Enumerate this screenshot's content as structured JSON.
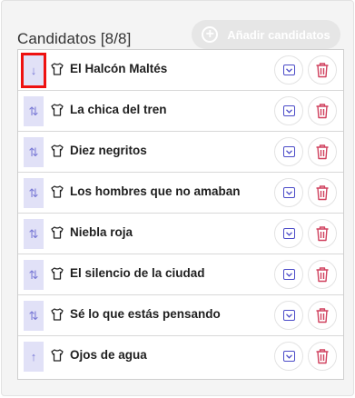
{
  "header": {
    "title": "Candidatos [8/8]",
    "add_button_label": "Añadir candidatos"
  },
  "colors": {
    "handle_bg": "#e1e1f7",
    "handle_arrow": "#7a7ad6",
    "expand_icon": "#4b4bc8",
    "delete_icon": "#d0415e",
    "selection_outline": "#ee1111"
  },
  "candidates": [
    {
      "name": "El Halcón Maltés",
      "handle": "↓",
      "selected": true
    },
    {
      "name": "La chica del tren",
      "handle": "⇅",
      "selected": false
    },
    {
      "name": "Diez negritos",
      "handle": "⇅",
      "selected": false
    },
    {
      "name": "Los hombres que no amaban",
      "handle": "⇅",
      "selected": false
    },
    {
      "name": "Niebla roja",
      "handle": "⇅",
      "selected": false
    },
    {
      "name": "El silencio de la ciudad",
      "handle": "⇅",
      "selected": false
    },
    {
      "name": "Sé lo que estás pensando",
      "handle": "⇅",
      "selected": false
    },
    {
      "name": "Ojos de agua",
      "handle": "↑",
      "selected": false
    }
  ]
}
